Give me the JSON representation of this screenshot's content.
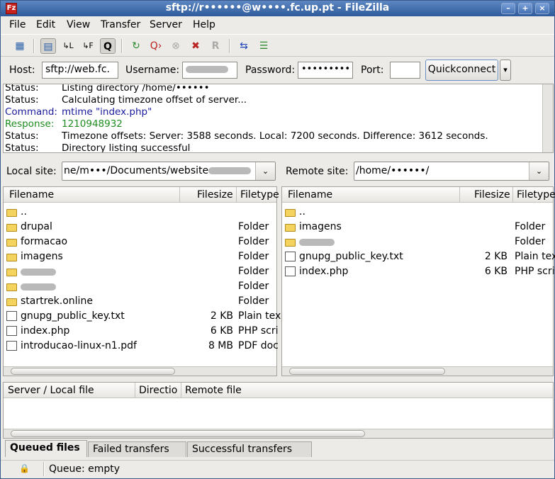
{
  "window": {
    "title": "sftp://r••••••@w••••.fc.up.pt - FileZilla",
    "app_icon": "Fz",
    "minimize": "–",
    "maximize": "+",
    "close": "×"
  },
  "menu": [
    "File",
    "Edit",
    "View",
    "Transfer",
    "Server",
    "Help"
  ],
  "toolbar": {
    "icons": [
      "site-manager-icon",
      "toggle-log-icon",
      "toggle-local-tree-icon",
      "toggle-remote-tree-icon",
      "toggle-queue-icon",
      "refresh-icon",
      "process-queue-icon",
      "cancel-icon",
      "disconnect-icon",
      "reconnect-icon",
      "compare-icon",
      "filter-icon"
    ]
  },
  "quickconnect": {
    "host_label": "Host:",
    "host_value": "sftp://web.fc.",
    "username_label": "Username:",
    "password_label": "Password:",
    "password_value": "•••••••••",
    "port_label": "Port:",
    "port_value": "",
    "button": "Quickconnect",
    "dropdown": "▾"
  },
  "log": [
    {
      "k": "Status:",
      "v": "Listing directory /home/••••••",
      "color": "#000000"
    },
    {
      "k": "Status:",
      "v": "Calculating timezone offset of server...",
      "color": "#000000"
    },
    {
      "k": "Command:",
      "v": "mtime \"index.php\"",
      "color": "#1a1a9c"
    },
    {
      "k": "Response:",
      "v": "1210948932",
      "color": "#1e8c1e"
    },
    {
      "k": "Status:",
      "v": "Timezone offsets: Server: 3588 seconds. Local: 7200 seconds. Difference: 3612 seconds.",
      "color": "#000000"
    },
    {
      "k": "Status:",
      "v": "Directory listing successful",
      "color": "#000000"
    }
  ],
  "local": {
    "label": "Local site:",
    "path": "ne/m•••/Documents/website",
    "headers": [
      "Filename",
      "Filesize",
      "Filetype"
    ],
    "files": [
      {
        "name": "..",
        "size": "",
        "type": "",
        "icon": "folder"
      },
      {
        "name": "drupal",
        "size": "",
        "type": "Folder",
        "icon": "folder"
      },
      {
        "name": "formacao",
        "size": "",
        "type": "Folder",
        "icon": "folder"
      },
      {
        "name": "imagens",
        "size": "",
        "type": "Folder",
        "icon": "folder"
      },
      {
        "name": "",
        "size": "",
        "type": "Folder",
        "icon": "folder"
      },
      {
        "name": "",
        "size": "",
        "type": "Folder",
        "icon": "folder"
      },
      {
        "name": "startrek.online",
        "size": "",
        "type": "Folder",
        "icon": "folder"
      },
      {
        "name": "gnupg_public_key.txt",
        "size": "2 KB",
        "type": "Plain tex",
        "icon": "doc"
      },
      {
        "name": "index.php",
        "size": "6 KB",
        "type": "PHP scri",
        "icon": "doc"
      },
      {
        "name": "introducao-linux-n1.pdf",
        "size": "8 MB",
        "type": "PDF doc",
        "icon": "doc"
      }
    ]
  },
  "remote": {
    "label": "Remote site:",
    "path": "/home/••••••/",
    "headers": [
      "Filename",
      "Filesize",
      "Filetype"
    ],
    "files": [
      {
        "name": "..",
        "size": "",
        "type": "",
        "icon": "folder"
      },
      {
        "name": "imagens",
        "size": "",
        "type": "Folder",
        "icon": "folder"
      },
      {
        "name": "",
        "size": "",
        "type": "Folder",
        "icon": "folder"
      },
      {
        "name": "gnupg_public_key.txt",
        "size": "2 KB",
        "type": "Plain tex",
        "icon": "doc"
      },
      {
        "name": "index.php",
        "size": "6 KB",
        "type": "PHP scri",
        "icon": "doc"
      }
    ]
  },
  "queue": {
    "headers": [
      "Server / Local file",
      "Directio",
      "Remote file"
    ]
  },
  "tabs": [
    "Queued files",
    "Failed transfers",
    "Successful transfers"
  ],
  "statusbar": {
    "text": "Queue: empty",
    "lock_icon": "🔒"
  }
}
